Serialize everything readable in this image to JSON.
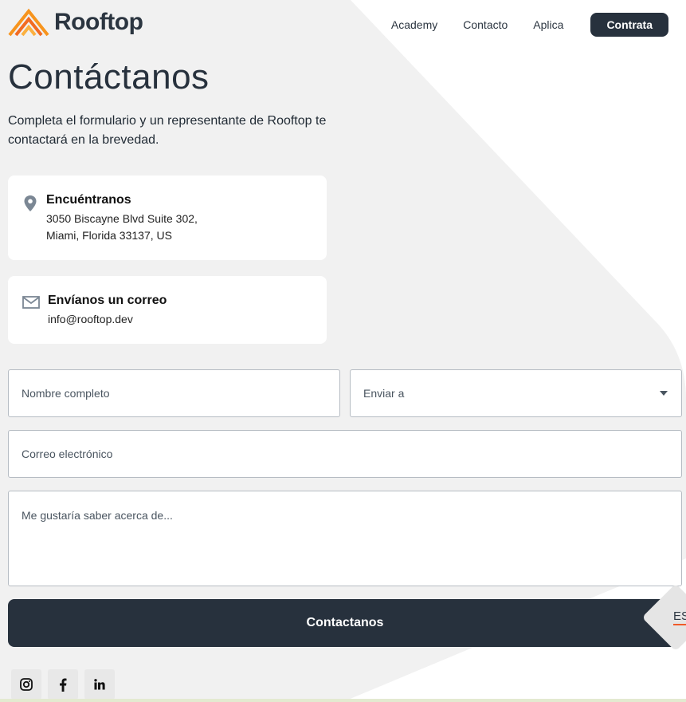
{
  "brand": {
    "name": "Rooftop",
    "accent": "#f7941d"
  },
  "nav": {
    "items": [
      "Academy",
      "Contacto",
      "Aplica"
    ],
    "cta": "Contrata"
  },
  "page": {
    "title": "Contáctanos",
    "lead": "Completa el formulario y un representante de Rooftop te contactará en la brevedad."
  },
  "cards": {
    "location": {
      "title": "Encuéntranos",
      "line1": "3050 Biscayne Blvd Suite 302,",
      "line2": "Miami, Florida 33137, US",
      "icon": "map-pin-icon"
    },
    "email": {
      "title": "Envíanos un correo",
      "line1": "info@rooftop.dev",
      "icon": "envelope-icon"
    }
  },
  "form": {
    "name_placeholder": "Nombre completo",
    "send_to_value": "Enviar a",
    "email_placeholder": "Correo electrónico",
    "message_placeholder": "Me gustaría saber acerca de...",
    "submit_label": "Contactanos"
  },
  "language": "ES",
  "social": [
    "instagram-icon",
    "facebook-icon",
    "linkedin-icon"
  ],
  "colors": {
    "dark": "#27313d",
    "background_shape": "#f1f1f1",
    "lang_underline": "#f05a28"
  }
}
